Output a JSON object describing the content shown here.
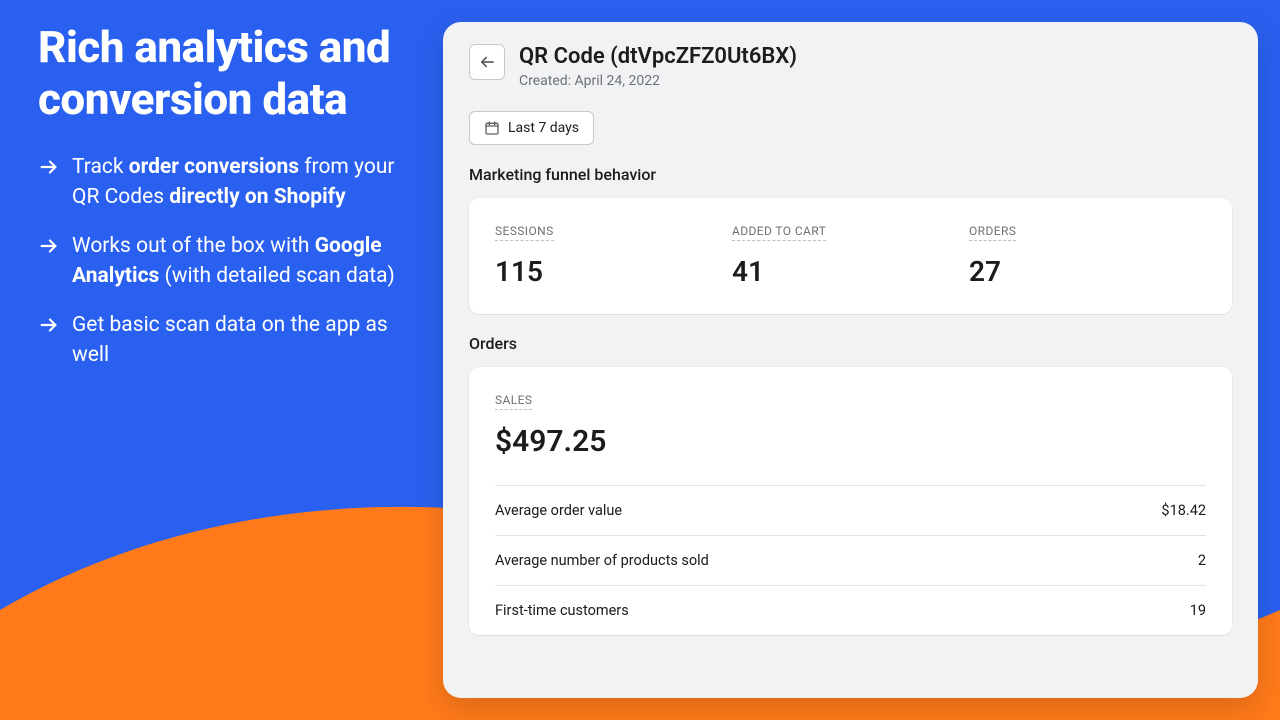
{
  "left": {
    "headline": "Rich analytics and conversion data",
    "bullets": [
      {
        "pre": "Track ",
        "b1": "order conversions",
        "mid": " from your QR Codes ",
        "b2": "directly on Shopify",
        "post": ""
      },
      {
        "pre": "Works out of the box with ",
        "b1": "Google Analytics",
        "mid": " (with detailed scan data)",
        "b2": "",
        "post": ""
      },
      {
        "pre": "Get basic scan data on the app as well",
        "b1": "",
        "mid": "",
        "b2": "",
        "post": ""
      }
    ]
  },
  "panel": {
    "title": "QR Code (dtVpcZFZ0Ut6BX)",
    "created": "Created: April 24, 2022",
    "range_label": "Last 7 days",
    "funnel": {
      "section": "Marketing funnel behavior",
      "metrics": [
        {
          "label": "SESSIONS",
          "value": "115"
        },
        {
          "label": "ADDED TO CART",
          "value": "41"
        },
        {
          "label": "ORDERS",
          "value": "27"
        }
      ]
    },
    "orders": {
      "section": "Orders",
      "sales_label": "SALES",
      "sales_value": "$497.25",
      "rows": [
        {
          "k": "Average order value",
          "v": "$18.42"
        },
        {
          "k": "Average number of products sold",
          "v": "2"
        },
        {
          "k": "First-time customers",
          "v": "19"
        }
      ]
    }
  }
}
